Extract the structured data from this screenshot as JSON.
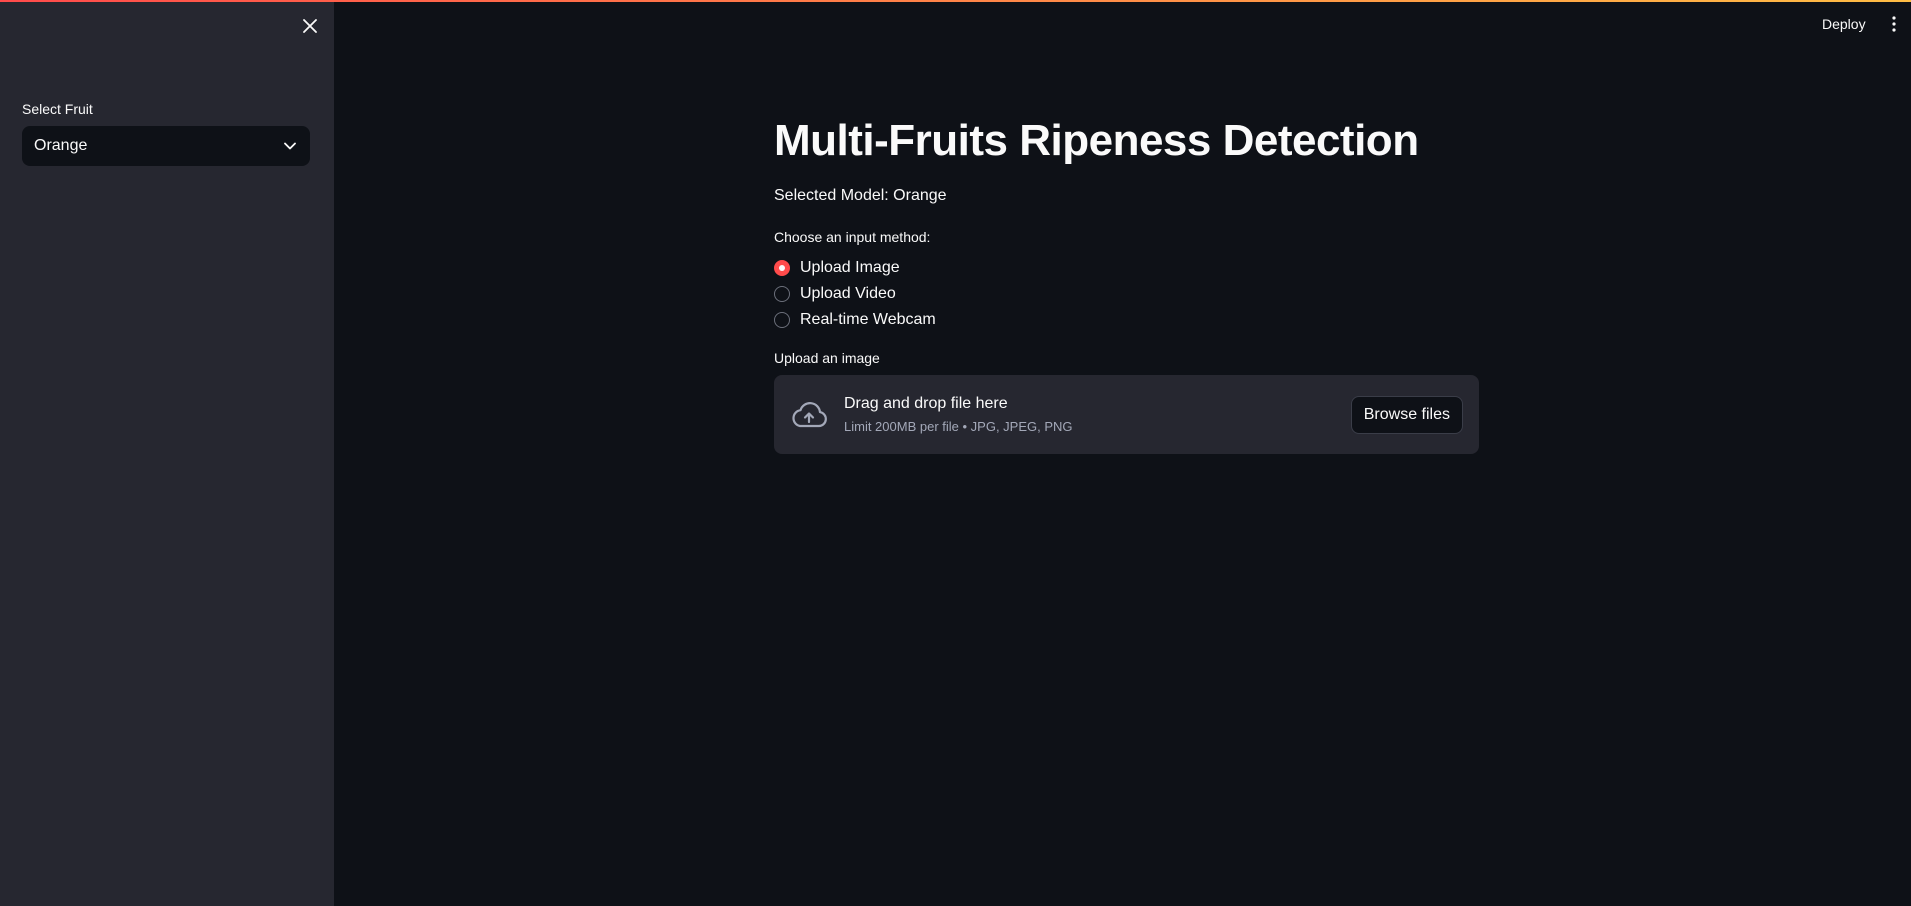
{
  "sidebar": {
    "close_icon": "close-icon",
    "select_label": "Select Fruit",
    "select_value": "Orange",
    "select_chevron_icon": "chevron-down-icon"
  },
  "header": {
    "deploy_label": "Deploy",
    "menu_icon": "more-vertical-icon"
  },
  "main": {
    "title": "Multi-Fruits Ripeness Detection",
    "selected_model_text": "Selected Model: Orange",
    "input_method": {
      "label": "Choose an input method:",
      "options": [
        {
          "label": "Upload Image",
          "checked": true
        },
        {
          "label": "Upload Video",
          "checked": false
        },
        {
          "label": "Real-time Webcam",
          "checked": false
        }
      ]
    },
    "uploader": {
      "label": "Upload an image",
      "icon": "cloud-upload-icon",
      "title": "Drag and drop file here",
      "subtitle": "Limit 200MB per file • JPG, JPEG, PNG",
      "button_label": "Browse files"
    }
  },
  "colors": {
    "accent": "#ff4b4b",
    "background": "#0e1117",
    "sidebar": "#262730",
    "text": "#fafafa"
  }
}
